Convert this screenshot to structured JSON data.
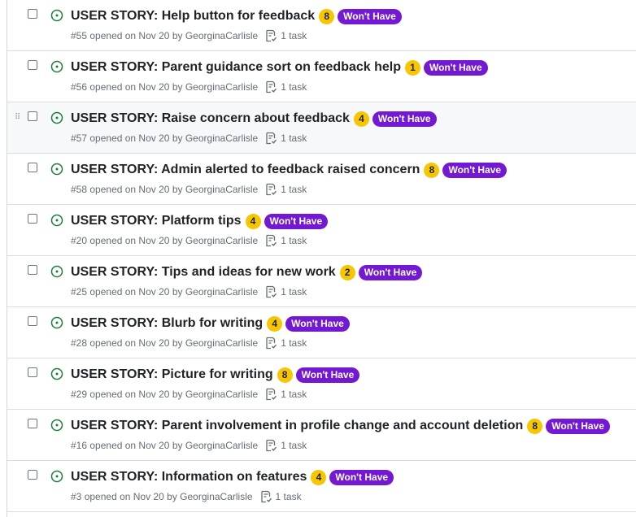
{
  "colors": {
    "open_icon": "#1a7f37",
    "estimate_badge": "#f7c600",
    "label_badge": "#7318d3",
    "meta_text": "#656d76",
    "hover_row": "#f6f8fa"
  },
  "icons": {
    "status": "issue-opened-icon",
    "task": "checklist-icon",
    "drag": "grabber-icon"
  },
  "issues": [
    {
      "title": "USER STORY: Help button for feedback",
      "estimate": "8",
      "label": "Won't Have",
      "number": "#55",
      "opened": "opened on Nov 20",
      "by": "by",
      "author": "GeorginaCarlisle",
      "tasks": "1 task"
    },
    {
      "title": "USER STORY: Parent guidance sort on feedback help",
      "estimate": "1",
      "label": "Won't Have",
      "number": "#56",
      "opened": "opened on Nov 20",
      "by": "by",
      "author": "GeorginaCarlisle",
      "tasks": "1 task"
    },
    {
      "title": "USER STORY: Raise concern about feedback",
      "estimate": "4",
      "label": "Won't Have",
      "number": "#57",
      "opened": "opened on Nov 20",
      "by": "by",
      "author": "GeorginaCarlisle",
      "tasks": "1 task"
    },
    {
      "title": "USER STORY: Admin alerted to feedback raised concern",
      "estimate": "8",
      "label": "Won't Have",
      "number": "#58",
      "opened": "opened on Nov 20",
      "by": "by",
      "author": "GeorginaCarlisle",
      "tasks": "1 task"
    },
    {
      "title": "USER STORY: Platform tips",
      "estimate": "4",
      "label": "Won't Have",
      "number": "#20",
      "opened": "opened on Nov 20",
      "by": "by",
      "author": "GeorginaCarlisle",
      "tasks": "1 task"
    },
    {
      "title": "USER STORY: Tips and ideas for new work",
      "estimate": "2",
      "label": "Won't Have",
      "number": "#25",
      "opened": "opened on Nov 20",
      "by": "by",
      "author": "GeorginaCarlisle",
      "tasks": "1 task"
    },
    {
      "title": "USER STORY: Blurb for writing",
      "estimate": "4",
      "label": "Won't Have",
      "number": "#28",
      "opened": "opened on Nov 20",
      "by": "by",
      "author": "GeorginaCarlisle",
      "tasks": "1 task"
    },
    {
      "title": "USER STORY: Picture for writing",
      "estimate": "8",
      "label": "Won't Have",
      "number": "#29",
      "opened": "opened on Nov 20",
      "by": "by",
      "author": "GeorginaCarlisle",
      "tasks": "1 task"
    },
    {
      "title": "USER STORY: Parent involvement in profile change and account deletion",
      "estimate": "8",
      "label": "Won't Have",
      "number": "#16",
      "opened": "opened on Nov 20",
      "by": "by",
      "author": "GeorginaCarlisle",
      "tasks": "1 task"
    },
    {
      "title": "USER STORY: Information on features",
      "estimate": "4",
      "label": "Won't Have",
      "number": "#3",
      "opened": "opened on Nov 20",
      "by": "by",
      "author": "GeorginaCarlisle",
      "tasks": "1 task"
    }
  ]
}
